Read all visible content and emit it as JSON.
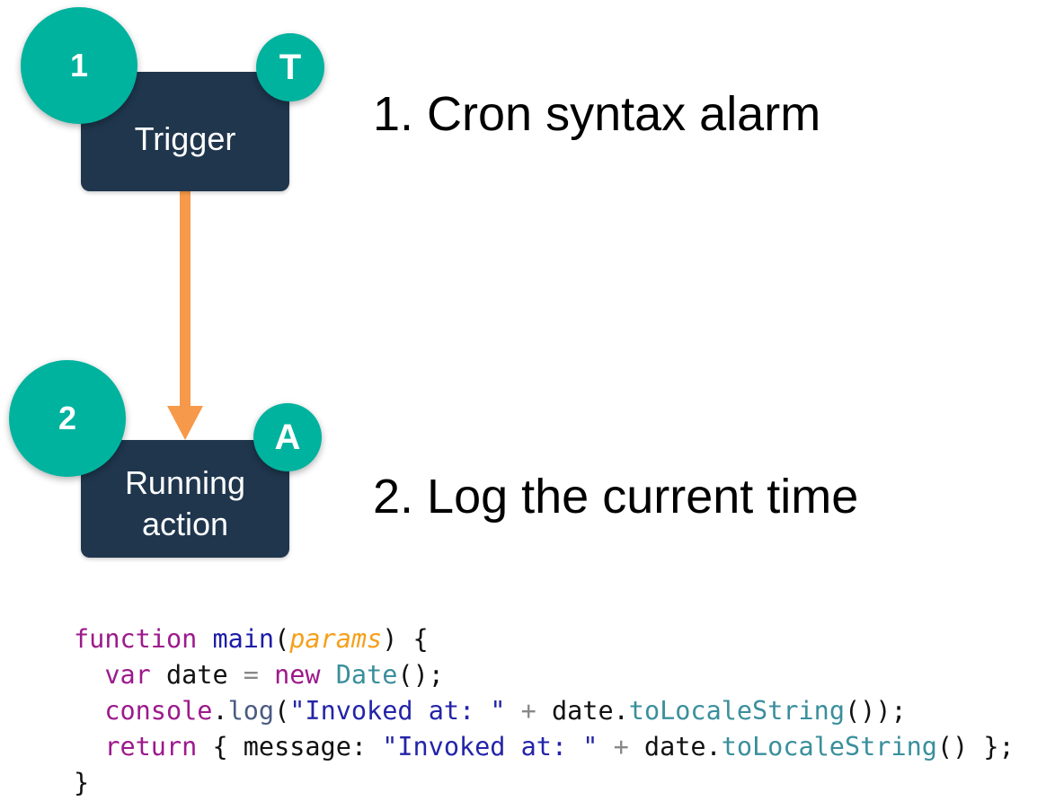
{
  "steps": [
    {
      "number": "1",
      "node_label": "Trigger",
      "badge": "T",
      "description": "1. Cron syntax alarm"
    },
    {
      "number": "2",
      "node_label": "Running action",
      "badge": "A",
      "description": "2. Log the current time"
    }
  ],
  "colors": {
    "node": "#1f364d",
    "badge": "#00b39e",
    "arrow": "#f7994a"
  },
  "code": {
    "l1": [
      "function",
      " ",
      "main",
      "(",
      "params",
      ") {"
    ],
    "l2": [
      "  ",
      "var",
      " date ",
      "=",
      " ",
      "new",
      " ",
      "Date",
      "();"
    ],
    "l3": [
      "  ",
      "console",
      ".",
      "log",
      "(",
      "\"Invoked at: \"",
      " ",
      "+",
      " date.",
      "toLocaleString",
      "());"
    ],
    "l4": [
      "  ",
      "return",
      " { message: ",
      "\"Invoked at: \"",
      " ",
      "+",
      " date.",
      "toLocaleString",
      "() };"
    ],
    "l5": [
      "}"
    ]
  }
}
